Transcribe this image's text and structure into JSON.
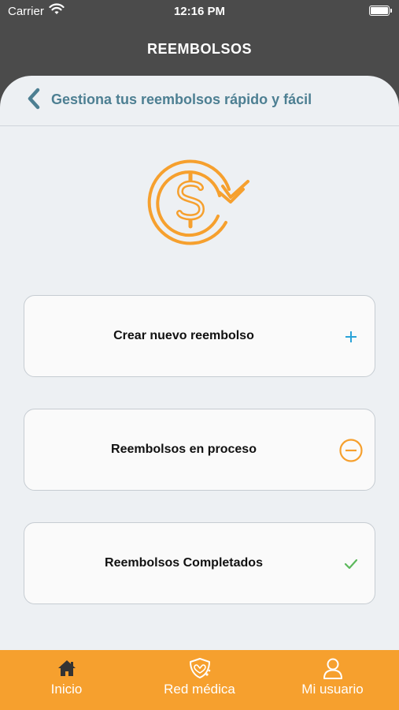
{
  "status_bar": {
    "carrier": "Carrier",
    "time": "12:16 PM"
  },
  "header": {
    "title": "REEMBOLSOS"
  },
  "sub_header": {
    "title": "Gestiona tus reembolsos rápido y fácil"
  },
  "options": [
    {
      "label": "Crear nuevo reembolso",
      "icon": "plus-icon"
    },
    {
      "label": "Reembolsos en proceso",
      "icon": "minus-circle-icon"
    },
    {
      "label": "Reembolsos Completados",
      "icon": "check-icon"
    }
  ],
  "tabs": [
    {
      "label": "Inicio",
      "icon": "home-icon"
    },
    {
      "label": "Red médica",
      "icon": "shield-medical-icon"
    },
    {
      "label": "Mi usuario",
      "icon": "user-icon"
    }
  ],
  "colors": {
    "header_bg": "#4b4b4b",
    "accent_orange": "#f6a02e",
    "subtitle_teal": "#4d7f92",
    "plus_blue": "#2aa3d8",
    "check_green": "#5cb85c"
  }
}
